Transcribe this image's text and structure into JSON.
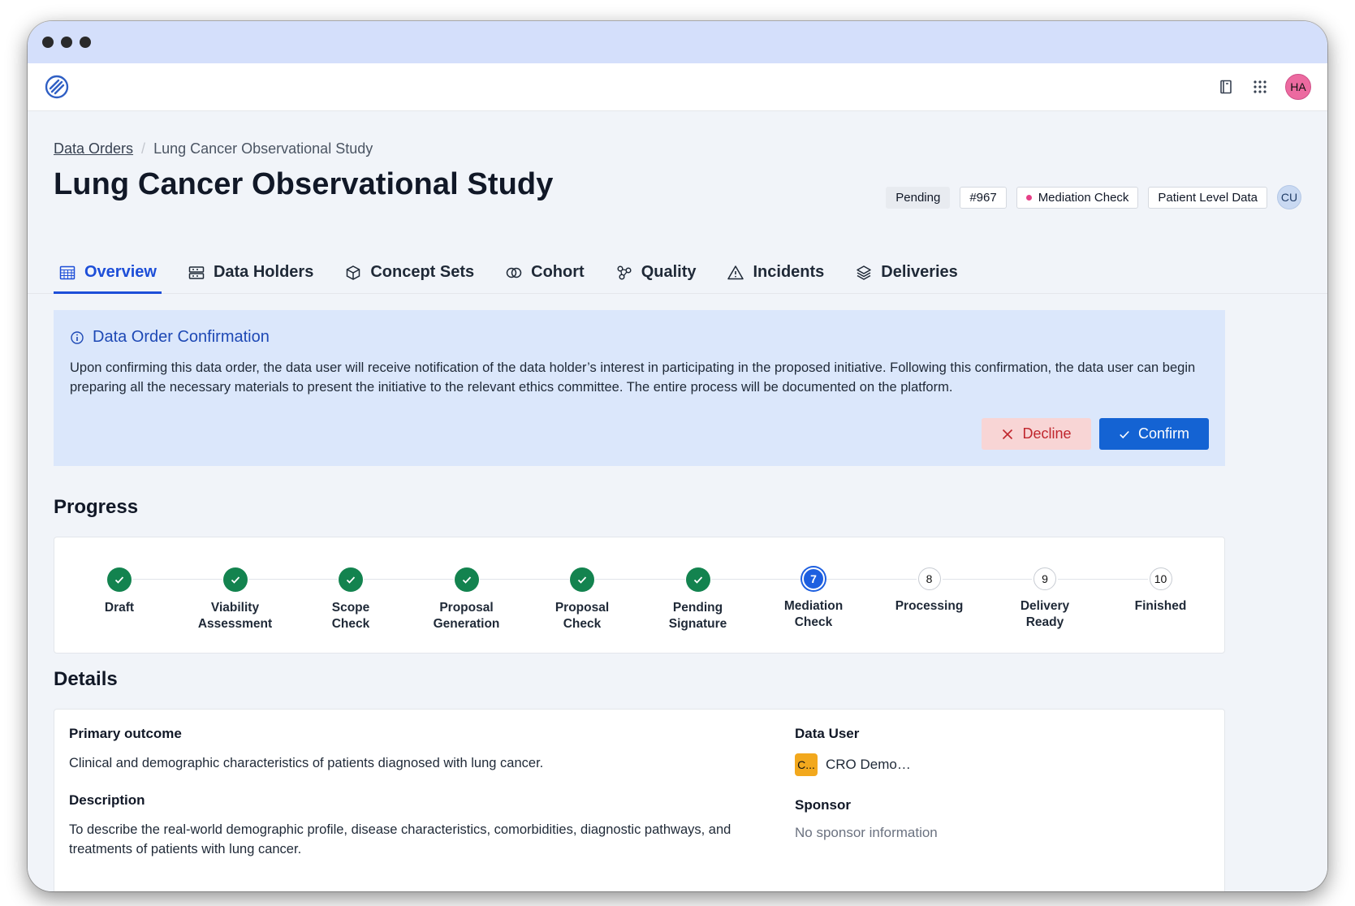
{
  "app": {
    "logo": "logo-icon",
    "user_initials": "HA"
  },
  "appbar_icons": [
    "book-icon",
    "apps-grid-icon"
  ],
  "breadcrumb": {
    "root": "Data Orders",
    "current": "Lung Cancer Observational Study"
  },
  "title": "Lung Cancer Observational Study",
  "badges": {
    "status": "Pending",
    "id": "#967",
    "stage": "Mediation Check",
    "type": "Patient Level Data",
    "user": "CU"
  },
  "colors": {
    "primary": "#1463d3",
    "success": "#13834f",
    "danger": "#c0262d",
    "stage_dot": "#e63f87"
  },
  "tabs": [
    {
      "label": "Overview",
      "icon": "table-icon",
      "active": true
    },
    {
      "label": "Data Holders",
      "icon": "server-icon"
    },
    {
      "label": "Concept Sets",
      "icon": "cube-icon"
    },
    {
      "label": "Cohort",
      "icon": "overlap-circles-icon"
    },
    {
      "label": "Quality",
      "icon": "nodes-icon"
    },
    {
      "label": "Incidents",
      "icon": "warning-icon"
    },
    {
      "label": "Deliveries",
      "icon": "layers-icon"
    }
  ],
  "banner": {
    "title": "Data Order Confirmation",
    "text": "Upon confirming this data order, the data user will receive notification of the data holder’s interest in participating in the proposed initiative. Following this confirmation, the data user can begin preparing all the necessary materials to present the initiative to the relevant ethics committee. The entire process will be documented on the platform.",
    "decline": "Decline",
    "confirm": "Confirm"
  },
  "progress": {
    "title": "Progress",
    "steps": [
      {
        "n": "1",
        "label": "Draft",
        "state": "done"
      },
      {
        "n": "2",
        "label": "Viability Assessment",
        "state": "done"
      },
      {
        "n": "3",
        "label": "Scope Check",
        "state": "done"
      },
      {
        "n": "4",
        "label": "Proposal Generation",
        "state": "done"
      },
      {
        "n": "5",
        "label": "Proposal Check",
        "state": "done"
      },
      {
        "n": "6",
        "label": "Pending Signature",
        "state": "done"
      },
      {
        "n": "7",
        "label": "Mediation Check",
        "state": "current"
      },
      {
        "n": "8",
        "label": "Processing",
        "state": "todo"
      },
      {
        "n": "9",
        "label": "Delivery Ready",
        "state": "todo"
      },
      {
        "n": "10",
        "label": "Finished",
        "state": "todo"
      }
    ]
  },
  "details": {
    "title": "Details",
    "primary_outcome_label": "Primary outcome",
    "primary_outcome": "Clinical and demographic characteristics of patients diagnosed with lung cancer.",
    "description_label": "Description",
    "description": "To describe the real-world demographic profile, disease characteristics, comorbidities, diagnostic pathways, and treatments of patients with lung cancer.",
    "data_user_label": "Data User",
    "data_user_icon": "C...",
    "data_user": "CRO Demo…",
    "sponsor_label": "Sponsor",
    "sponsor": "No sponsor information"
  }
}
